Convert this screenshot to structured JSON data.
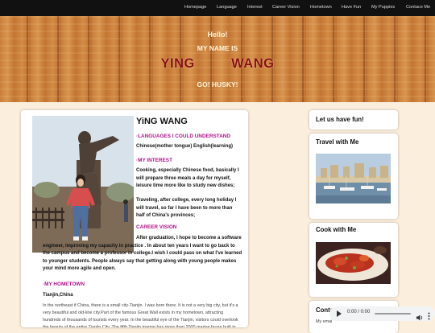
{
  "nav": {
    "items": [
      "Homepage",
      "Language",
      "Interest",
      "Career Vision",
      "Hometown",
      "Have Fun",
      "My Puppies",
      "Contace Me"
    ]
  },
  "hero": {
    "hello": "Hello!",
    "my_name_is": "MY NAME IS",
    "name": "YING   WANG",
    "go": "GO! HUSKY!"
  },
  "main": {
    "name": "YiNG WANG",
    "languages_heading": "·LANGUAGES I COULD UNDERSTAND",
    "languages_text": "Chinese(mother tongue) English(learning)",
    "interest_heading": "·MY INTEREST",
    "interest_text_1": "Cooking, especially Chinese food, basically I will prepare three meals a day for myself, leisure time more like to study new dishes;",
    "interest_text_2": "Traveling, after college, every long holiday I will travel, so far I have been to more than half of China's provinces;",
    "career_heading": "CAREER VISION",
    "career_text": "After graduation, I hope to become a software engineer, improving my capacity in practice . In about ten years I want to go back to the campus and become a professor in college.I wish I could pass on what I've learned to younger students. People always say that getting along with young people makes your mind more agile and open.",
    "hometown_heading": "·MY HOMETOWN",
    "hometown_city": "Tianjin,China",
    "hometown_text": "In the northeast if China, there is a small city-Tianjin. I was born there. It is not a very big city, but it's a very beautiful and old-line city.Part of the famous Great Wall exists in my hometown, attracting hundreds of thousands of tourists every year. In the beautiful eye of the Tianjin, visitors could overlook the beauty of the entire Tianjin City. The fifth Tianjin marine has more than 2000 marine fauna built in"
  },
  "side": {
    "fun_title": "Let us have fun!",
    "travel_title": "Travel with Me",
    "cook_title": "Cook with Me",
    "contact_title": "Conta",
    "contact_text": "My emai"
  },
  "audio": {
    "time": "0:00 / 0:00"
  },
  "colors": {
    "nav_bg": "#111111",
    "accent_pink": "#b0128a",
    "hero_name": "#8a0e0e",
    "page_bg": "#fbeedc"
  }
}
